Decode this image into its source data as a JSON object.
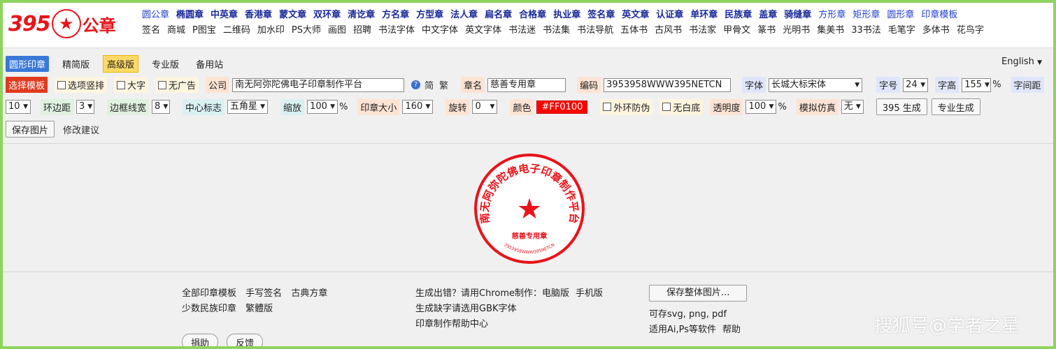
{
  "logo": {
    "number": "395",
    "text": "公章"
  },
  "nav_row1": [
    "圆公章",
    "椭圆章",
    "中英章",
    "香港章",
    "蒙文章",
    "双环章",
    "清讫章",
    "方名章",
    "方型章",
    "法人章",
    "扁名章",
    "合格章",
    "执业章",
    "签名章",
    "英文章",
    "认证章",
    "单环章",
    "民族章",
    "盖章",
    "骑缝章",
    "方形章",
    "矩形章",
    "圆形章",
    "印章模板"
  ],
  "nav_row2": [
    "签名",
    "商城",
    "P图宝",
    "二维码",
    "加水印",
    "PS大师",
    "画图",
    "招聘",
    "书法字体",
    "中文字体",
    "英文字体",
    "书法迷",
    "书法集",
    "书法导航",
    "五体书",
    "古风书",
    "书法家",
    "甲骨文",
    "篆书",
    "光明书",
    "集美书",
    "33书法",
    "毛笔字",
    "多体书",
    "花鸟字"
  ],
  "tabs": [
    "圆形印章",
    "精简版",
    "高级版",
    "专业版",
    "备用站"
  ],
  "language": "English",
  "row2": {
    "choose_template": "选择模板",
    "options": [
      "选项竖排",
      "大字",
      "无广告"
    ],
    "company_label": "公司",
    "company_value": "南无阿弥陀佛电子印章制作平台",
    "simp": "简",
    "trad": "繁",
    "seal_name_label": "章名",
    "seal_name_value": "慈善专用章",
    "code_label": "编码",
    "code_value": "3953958WWW395NETCN",
    "font_label": "字体",
    "font_value": "长城大标宋体",
    "font_size_label": "字号",
    "font_size_value": "24",
    "char_height_label": "字高",
    "char_height_value": "155",
    "pct": "%",
    "spacing_label": "字间距"
  },
  "row3": {
    "spacing_value": "10",
    "ring_gap_label": "环边距",
    "ring_gap_value": "3",
    "border_width_label": "边框线宽",
    "border_width_value": "8",
    "center_label": "中心标志",
    "center_value": "五角星",
    "scale_label": "缩放",
    "scale_value": "100",
    "size_label": "印章大小",
    "size_value": "160",
    "rotate_label": "旋转",
    "rotate_value": "0",
    "color_label": "颜色",
    "color_value": "#FF0100",
    "outer_anti": "外环防伪",
    "no_white": "无白底",
    "opacity_label": "透明度",
    "opacity_value": "100",
    "simulate_label": "模拟仿真",
    "simulate_value": "无",
    "gen_395": "395 生成",
    "gen_pro": "专业生成"
  },
  "row4": {
    "save_image": "保存图片",
    "suggest": "修改建议"
  },
  "seal": {
    "arc_text": "南无阿弥陀佛电子印章制作平台",
    "name_text": "慈善专用章",
    "code_text": "3953958WWW395NETCN",
    "color": "#e8141b"
  },
  "footer": {
    "col1_row1": [
      "全部印章模板",
      "手写签名",
      "古典方章"
    ],
    "col1_row2": [
      "少数民族印章",
      "繁體版"
    ],
    "col2_line1_prefix": "生成出错？请用Chrome制作：",
    "col2_link1": "电脑版",
    "col2_link2": "手机版",
    "col2_line2": "生成缺字请选用GBK字体",
    "col2_line3": "印章制作帮助中心",
    "save_whole": "保存整体图片...",
    "formats": "可存svg, png, pdf",
    "software": "适用Ai,Ps等软件",
    "help": "帮助",
    "donate": "捐助",
    "feedback": "反馈"
  },
  "watermark": "搜狐号@学者之星"
}
